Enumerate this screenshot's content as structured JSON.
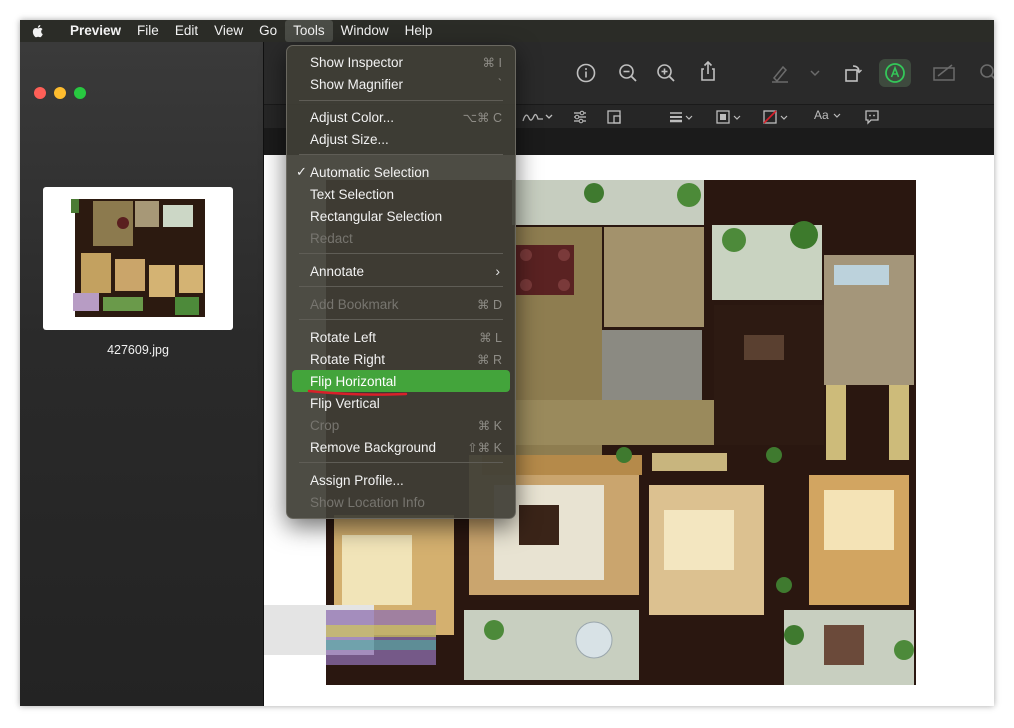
{
  "menubar": {
    "app_name": "Preview",
    "items": [
      "File",
      "Edit",
      "View",
      "Go",
      "Tools",
      "Window",
      "Help"
    ]
  },
  "sidebar": {
    "file_name": "427609.jpg"
  },
  "tools_menu": {
    "items": {
      "show_inspector": {
        "label": "Show Inspector",
        "shortcut": "⌘ I"
      },
      "show_magnifier": {
        "label": "Show Magnifier",
        "shortcut": "`"
      },
      "adjust_color": {
        "label": "Adjust Color...",
        "shortcut": "⌥⌘ C"
      },
      "adjust_size": {
        "label": "Adjust Size..."
      },
      "automatic_selection": {
        "label": "Automatic Selection",
        "check": "✓"
      },
      "text_selection": {
        "label": "Text Selection"
      },
      "rectangular_selection": {
        "label": "Rectangular Selection"
      },
      "redact": {
        "label": "Redact"
      },
      "annotate": {
        "label": "Annotate",
        "arrow": "›"
      },
      "add_bookmark": {
        "label": "Add Bookmark",
        "shortcut": "⌘ D"
      },
      "rotate_left": {
        "label": "Rotate Left",
        "shortcut": "⌘ L"
      },
      "rotate_right": {
        "label": "Rotate Right",
        "shortcut": "⌘ R"
      },
      "flip_horizontal": {
        "label": "Flip Horizontal"
      },
      "flip_vertical": {
        "label": "Flip Vertical"
      },
      "crop": {
        "label": "Crop",
        "shortcut": "⌘ K"
      },
      "remove_background": {
        "label": "Remove Background",
        "shortcut": "⇧⌘ K"
      },
      "assign_profile": {
        "label": "Assign Profile..."
      },
      "show_location_info": {
        "label": "Show Location Info"
      }
    }
  },
  "markup": {
    "text_style": "Aa"
  },
  "colors": {
    "highlight": "#43a43b",
    "annotation_red": "#d8202a",
    "close": "#fe5f57",
    "minimize": "#febc2e",
    "zoom": "#28c840"
  },
  "icons": [
    "apple-icon",
    "info-icon",
    "zoom-out-icon",
    "zoom-in-icon",
    "share-icon",
    "highlight-pen-icon",
    "rotate-icon",
    "markup-icon",
    "sign-icon",
    "search-icon"
  ]
}
